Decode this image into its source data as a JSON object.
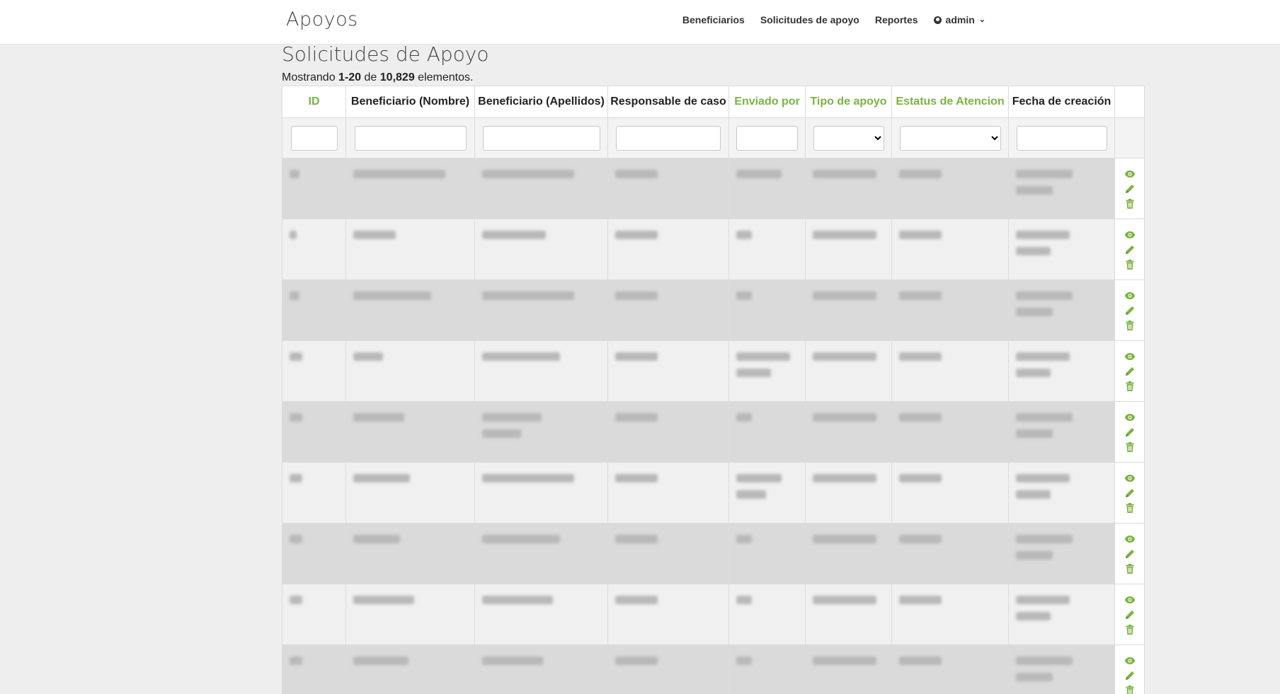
{
  "brand": "Apoyos",
  "nav": {
    "beneficiarios": "Beneficiarios",
    "solicitudes": "Solicitudes de apoyo",
    "reportes": "Reportes",
    "user": "admin"
  },
  "page_title": "Solicitudes de Apoyo",
  "summary": {
    "prefix": "Mostrando",
    "range": "1-20",
    "middle": "de",
    "total": "10,829",
    "suffix": "elementos."
  },
  "columns": [
    {
      "label": "ID",
      "sortable": true
    },
    {
      "label": "Beneficiario (Nombre)",
      "sortable": false
    },
    {
      "label": "Beneficiario (Apellidos)",
      "sortable": false
    },
    {
      "label": "Responsable de caso",
      "sortable": false
    },
    {
      "label": "Enviado por",
      "sortable": true
    },
    {
      "label": "Tipo de apoyo",
      "sortable": true
    },
    {
      "label": "Estatus de Atencion",
      "sortable": true
    },
    {
      "label": "Fecha de creación",
      "sortable": false
    }
  ],
  "colors": {
    "accent": "#7cb342",
    "row_odd": "#dadada",
    "row_even": "#f0f0f0"
  },
  "icons": {
    "view": "eye-icon",
    "edit": "pencil-icon",
    "delete": "trash-icon"
  }
}
